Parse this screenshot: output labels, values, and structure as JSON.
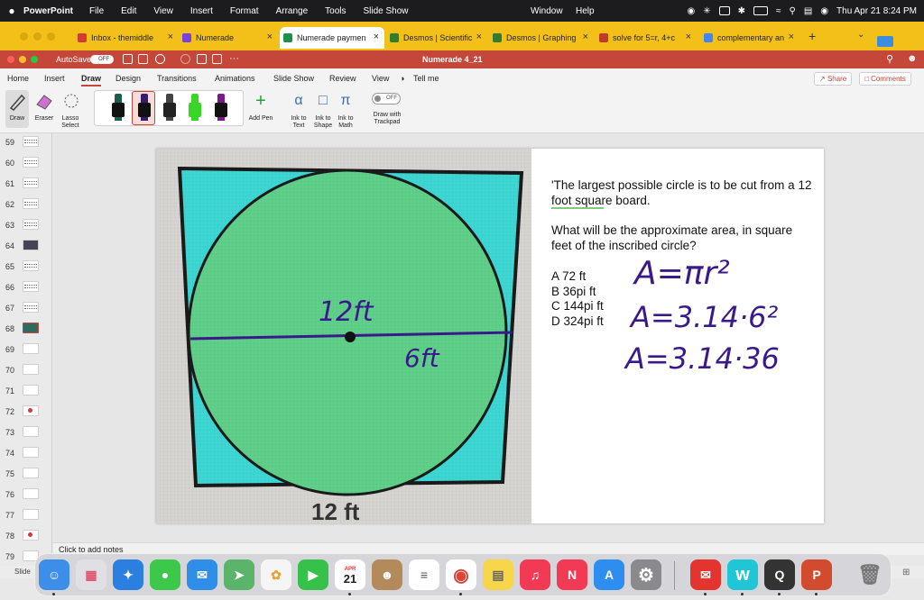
{
  "menubar": {
    "app": "PowerPoint",
    "items": [
      "File",
      "Edit",
      "View",
      "Insert",
      "Format",
      "Arrange",
      "Tools",
      "Slide Show"
    ],
    "right_items": [
      "Window",
      "Help"
    ],
    "datetime": "Thu Apr 21  8:24 PM"
  },
  "browser": {
    "tabs": [
      {
        "label": "Inbox - themiddle",
        "color": "#d23a3a"
      },
      {
        "label": "Numerade",
        "color": "#7a3fe0"
      },
      {
        "label": "Numerade paymen",
        "color": "#1e8f4a",
        "active": true
      },
      {
        "label": "Desmos | Scientific",
        "color": "#2e7d32"
      },
      {
        "label": "Desmos | Graphing",
        "color": "#2e7d32"
      },
      {
        "label": "solve for 5=r, 4+c",
        "color": "#c0392b"
      },
      {
        "label": "complementary an",
        "color": "#4285f4"
      }
    ]
  },
  "ppt": {
    "autosave_label": "AutoSave",
    "autosave_state": "OFF",
    "document_title": "Numerade 4_21",
    "ribbon_tabs": [
      "Home",
      "Insert",
      "Draw",
      "Design",
      "Transitions",
      "Animations",
      "Slide Show",
      "Review",
      "View"
    ],
    "tell_me": "Tell me",
    "share": "Share",
    "comments": "Comments",
    "tools": {
      "draw": "Draw",
      "eraser": "Eraser",
      "lasso": "Lasso Select",
      "add_pen": "Add Pen",
      "ink_text": "Ink to Text",
      "ink_shape": "Ink to Shape",
      "ink_math": "Ink to Math",
      "toggle_state": "OFF",
      "draw_trackpad": "Draw with Trackpad"
    },
    "pens": [
      "#1b5e4f",
      "#3a1a6b",
      "#333333",
      "#39d62a",
      "#7a1a8a"
    ],
    "slide_numbers": [
      "59",
      "60",
      "61",
      "62",
      "63",
      "64",
      "65",
      "66",
      "67",
      "68",
      "69",
      "70",
      "71",
      "72",
      "73",
      "74",
      "75",
      "76",
      "77",
      "78",
      "79"
    ],
    "selected_slide": "68",
    "notes_placeholder": "Click to add notes",
    "status_label": "Slide"
  },
  "slide": {
    "question_1": "'The largest possible circle is to be cut from a 12 foot square board.",
    "question_2": "What will be the approximate area, in square feet of the inscribed circle?",
    "answers": [
      "A 72 ft",
      "B 36pi ft",
      "C 144pi ft",
      "D 324pi ft"
    ],
    "photo_bottom_label": "12 ft",
    "handwriting": {
      "diameter": "12ft",
      "radius": "6ft",
      "line1": "A=πr²",
      "line2": "A=3.14·6²",
      "line3": "A=3.14·36"
    },
    "colors": {
      "board": "#3ed6d2",
      "circle": "#5fcf8a",
      "ink": "#3a1a8a"
    }
  },
  "dock": {
    "apps": [
      {
        "name": "finder-icon",
        "color": "#3d8ee8",
        "glyph": "☺"
      },
      {
        "name": "launchpad-icon",
        "color": "#e8e8ea",
        "glyph": "▦"
      },
      {
        "name": "safari-icon",
        "color": "#2b7fe0",
        "glyph": "✦"
      },
      {
        "name": "messages-icon",
        "color": "#3cc84a",
        "glyph": "●"
      },
      {
        "name": "mail-icon",
        "color": "#2f8fe8",
        "glyph": "✉"
      },
      {
        "name": "maps-icon",
        "color": "#5ab56a",
        "glyph": "➤"
      },
      {
        "name": "photos-icon",
        "color": "#f5f5f5",
        "glyph": "✿"
      },
      {
        "name": "facetime-icon",
        "color": "#36c14a",
        "glyph": "▶"
      },
      {
        "name": "calendar-icon",
        "color": "#ffffff",
        "glyph": "21"
      },
      {
        "name": "contacts-icon",
        "color": "#b38b5a",
        "glyph": "☻"
      },
      {
        "name": "reminders-icon",
        "color": "#ffffff",
        "glyph": "≡"
      },
      {
        "name": "chrome-icon",
        "color": "#ffffff",
        "glyph": "◉"
      },
      {
        "name": "notes-icon",
        "color": "#f7d64a",
        "glyph": "▤"
      },
      {
        "name": "music-icon",
        "color": "#f23a55",
        "glyph": "♫"
      },
      {
        "name": "news-icon",
        "color": "#f23a55",
        "glyph": "N"
      },
      {
        "name": "appstore-icon",
        "color": "#2d8ef0",
        "glyph": "A"
      },
      {
        "name": "settings-icon",
        "color": "#8a8a8e",
        "glyph": "⚙"
      },
      {
        "name": "gmail-icon",
        "color": "#e3342f",
        "glyph": "✉"
      },
      {
        "name": "numerade-icon",
        "color": "#1ec6d6",
        "glyph": "w"
      },
      {
        "name": "quicktime-icon",
        "color": "#333333",
        "glyph": "Q"
      },
      {
        "name": "powerpoint-icon",
        "color": "#d24b2f",
        "glyph": "P"
      }
    ],
    "calendar_month": "APR",
    "calendar_day": "21"
  }
}
